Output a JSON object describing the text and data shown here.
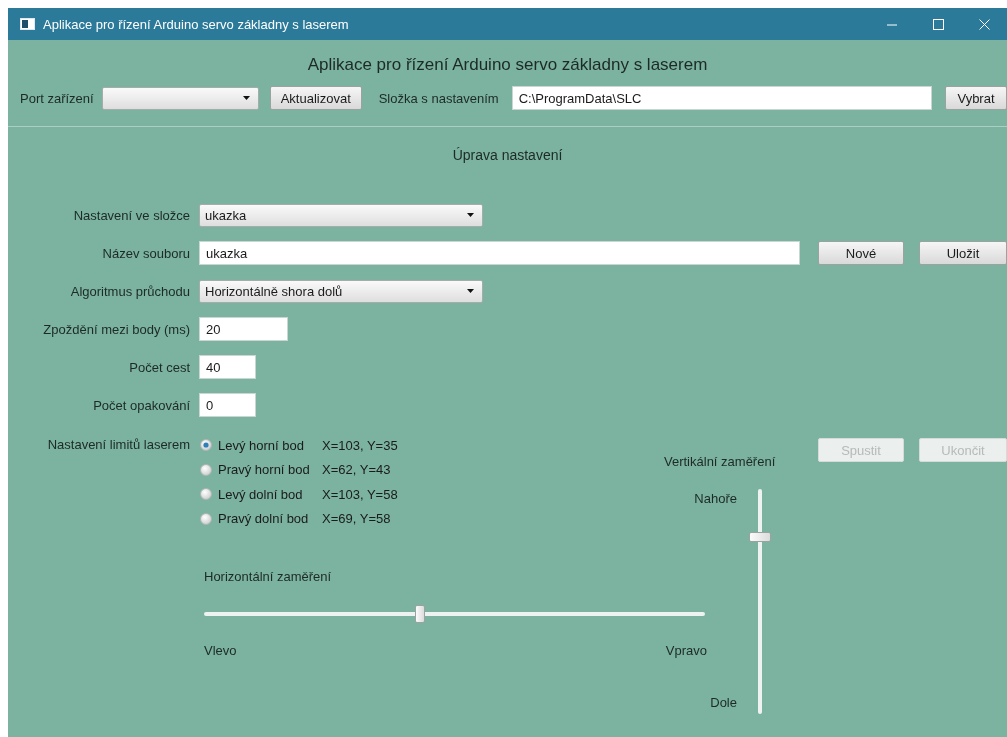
{
  "window": {
    "title": "Aplikace pro řízení Arduino servo základny s laserem"
  },
  "header": {
    "title": "Aplikace pro řízení Arduino servo základny s laserem"
  },
  "toolbar": {
    "port_label": "Port zařízení",
    "refresh_button": "Aktualizovat",
    "folder_label": "Složka s nastavením",
    "folder_field": "C:\\ProgramData\\SLC",
    "choose_button": "Vybrat"
  },
  "section_title": "Úprava nastavení",
  "form": [
    {
      "kind": "select",
      "label": "Nastavení ve složce",
      "value": "ukazka"
    },
    {
      "kind": "wide-field",
      "label": "Název souboru",
      "value": "ukazka",
      "buttons": [
        {
          "label": "Nové",
          "disabled": false
        },
        {
          "label": "Uložit",
          "disabled": false
        }
      ]
    },
    {
      "kind": "select",
      "label": "Algoritmus průchodu",
      "value": "Horizontálně shora dolů"
    },
    {
      "kind": "field",
      "label": "Zpoždění mezi body (ms)",
      "value": "20"
    },
    {
      "kind": "short-field",
      "label": "Počet cest",
      "value": "40"
    },
    {
      "kind": "short-field",
      "label": "Počet opakování",
      "value": "0"
    }
  ],
  "limits": {
    "label": "Nastavení limitů laserem",
    "points": [
      {
        "label": "Levý horní bod",
        "coords": "X=103, Y=35",
        "selected": true
      },
      {
        "label": "Pravý horní bod",
        "coords": "X=62, Y=43",
        "selected": false
      },
      {
        "label": "Levý dolní bod",
        "coords": "X=103, Y=58",
        "selected": false
      },
      {
        "label": "Pravý dolní bod",
        "coords": "X=69, Y=58",
        "selected": false
      }
    ]
  },
  "actions": [
    {
      "label": "Spustit",
      "disabled": true
    },
    {
      "label": "Ukončit",
      "disabled": true
    }
  ],
  "horizontal": {
    "title": "Horizontální zaměření",
    "level": 0.43,
    "min_label": "Vlevo",
    "max_label": "Vpravo"
  },
  "vertical": {
    "title": "Vertikální zaměření",
    "level": 0.8,
    "max_label": "Nahoře",
    "min_label": "Dole"
  }
}
